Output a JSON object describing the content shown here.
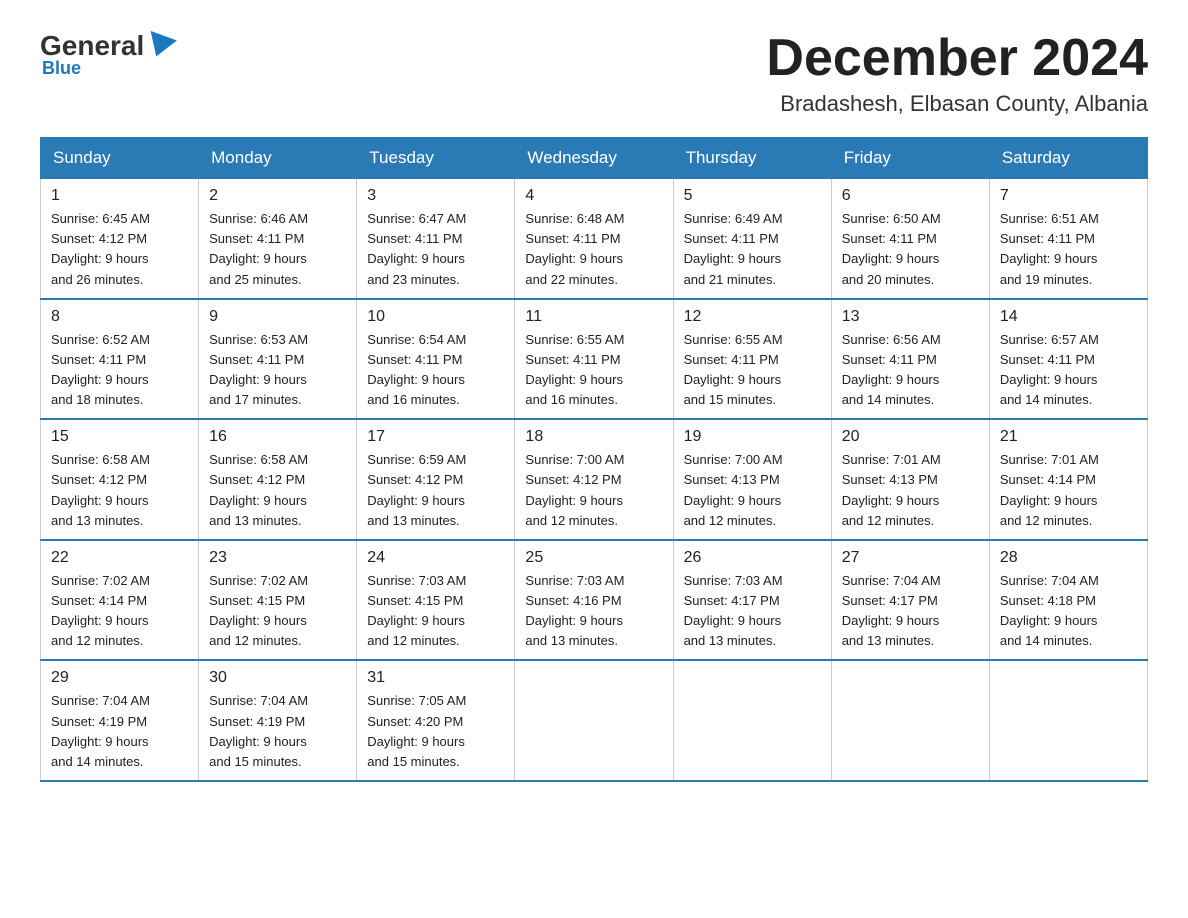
{
  "logo": {
    "general": "General",
    "blue": "Blue"
  },
  "header": {
    "month": "December 2024",
    "location": "Bradashesh, Elbasan County, Albania"
  },
  "days_of_week": [
    "Sunday",
    "Monday",
    "Tuesday",
    "Wednesday",
    "Thursday",
    "Friday",
    "Saturday"
  ],
  "weeks": [
    [
      {
        "day": "1",
        "sunrise": "6:45 AM",
        "sunset": "4:12 PM",
        "daylight": "9 hours and 26 minutes."
      },
      {
        "day": "2",
        "sunrise": "6:46 AM",
        "sunset": "4:11 PM",
        "daylight": "9 hours and 25 minutes."
      },
      {
        "day": "3",
        "sunrise": "6:47 AM",
        "sunset": "4:11 PM",
        "daylight": "9 hours and 23 minutes."
      },
      {
        "day": "4",
        "sunrise": "6:48 AM",
        "sunset": "4:11 PM",
        "daylight": "9 hours and 22 minutes."
      },
      {
        "day": "5",
        "sunrise": "6:49 AM",
        "sunset": "4:11 PM",
        "daylight": "9 hours and 21 minutes."
      },
      {
        "day": "6",
        "sunrise": "6:50 AM",
        "sunset": "4:11 PM",
        "daylight": "9 hours and 20 minutes."
      },
      {
        "day": "7",
        "sunrise": "6:51 AM",
        "sunset": "4:11 PM",
        "daylight": "9 hours and 19 minutes."
      }
    ],
    [
      {
        "day": "8",
        "sunrise": "6:52 AM",
        "sunset": "4:11 PM",
        "daylight": "9 hours and 18 minutes."
      },
      {
        "day": "9",
        "sunrise": "6:53 AM",
        "sunset": "4:11 PM",
        "daylight": "9 hours and 17 minutes."
      },
      {
        "day": "10",
        "sunrise": "6:54 AM",
        "sunset": "4:11 PM",
        "daylight": "9 hours and 16 minutes."
      },
      {
        "day": "11",
        "sunrise": "6:55 AM",
        "sunset": "4:11 PM",
        "daylight": "9 hours and 16 minutes."
      },
      {
        "day": "12",
        "sunrise": "6:55 AM",
        "sunset": "4:11 PM",
        "daylight": "9 hours and 15 minutes."
      },
      {
        "day": "13",
        "sunrise": "6:56 AM",
        "sunset": "4:11 PM",
        "daylight": "9 hours and 14 minutes."
      },
      {
        "day": "14",
        "sunrise": "6:57 AM",
        "sunset": "4:11 PM",
        "daylight": "9 hours and 14 minutes."
      }
    ],
    [
      {
        "day": "15",
        "sunrise": "6:58 AM",
        "sunset": "4:12 PM",
        "daylight": "9 hours and 13 minutes."
      },
      {
        "day": "16",
        "sunrise": "6:58 AM",
        "sunset": "4:12 PM",
        "daylight": "9 hours and 13 minutes."
      },
      {
        "day": "17",
        "sunrise": "6:59 AM",
        "sunset": "4:12 PM",
        "daylight": "9 hours and 13 minutes."
      },
      {
        "day": "18",
        "sunrise": "7:00 AM",
        "sunset": "4:12 PM",
        "daylight": "9 hours and 12 minutes."
      },
      {
        "day": "19",
        "sunrise": "7:00 AM",
        "sunset": "4:13 PM",
        "daylight": "9 hours and 12 minutes."
      },
      {
        "day": "20",
        "sunrise": "7:01 AM",
        "sunset": "4:13 PM",
        "daylight": "9 hours and 12 minutes."
      },
      {
        "day": "21",
        "sunrise": "7:01 AM",
        "sunset": "4:14 PM",
        "daylight": "9 hours and 12 minutes."
      }
    ],
    [
      {
        "day": "22",
        "sunrise": "7:02 AM",
        "sunset": "4:14 PM",
        "daylight": "9 hours and 12 minutes."
      },
      {
        "day": "23",
        "sunrise": "7:02 AM",
        "sunset": "4:15 PM",
        "daylight": "9 hours and 12 minutes."
      },
      {
        "day": "24",
        "sunrise": "7:03 AM",
        "sunset": "4:15 PM",
        "daylight": "9 hours and 12 minutes."
      },
      {
        "day": "25",
        "sunrise": "7:03 AM",
        "sunset": "4:16 PM",
        "daylight": "9 hours and 13 minutes."
      },
      {
        "day": "26",
        "sunrise": "7:03 AM",
        "sunset": "4:17 PM",
        "daylight": "9 hours and 13 minutes."
      },
      {
        "day": "27",
        "sunrise": "7:04 AM",
        "sunset": "4:17 PM",
        "daylight": "9 hours and 13 minutes."
      },
      {
        "day": "28",
        "sunrise": "7:04 AM",
        "sunset": "4:18 PM",
        "daylight": "9 hours and 14 minutes."
      }
    ],
    [
      {
        "day": "29",
        "sunrise": "7:04 AM",
        "sunset": "4:19 PM",
        "daylight": "9 hours and 14 minutes."
      },
      {
        "day": "30",
        "sunrise": "7:04 AM",
        "sunset": "4:19 PM",
        "daylight": "9 hours and 15 minutes."
      },
      {
        "day": "31",
        "sunrise": "7:05 AM",
        "sunset": "4:20 PM",
        "daylight": "9 hours and 15 minutes."
      },
      null,
      null,
      null,
      null
    ]
  ]
}
